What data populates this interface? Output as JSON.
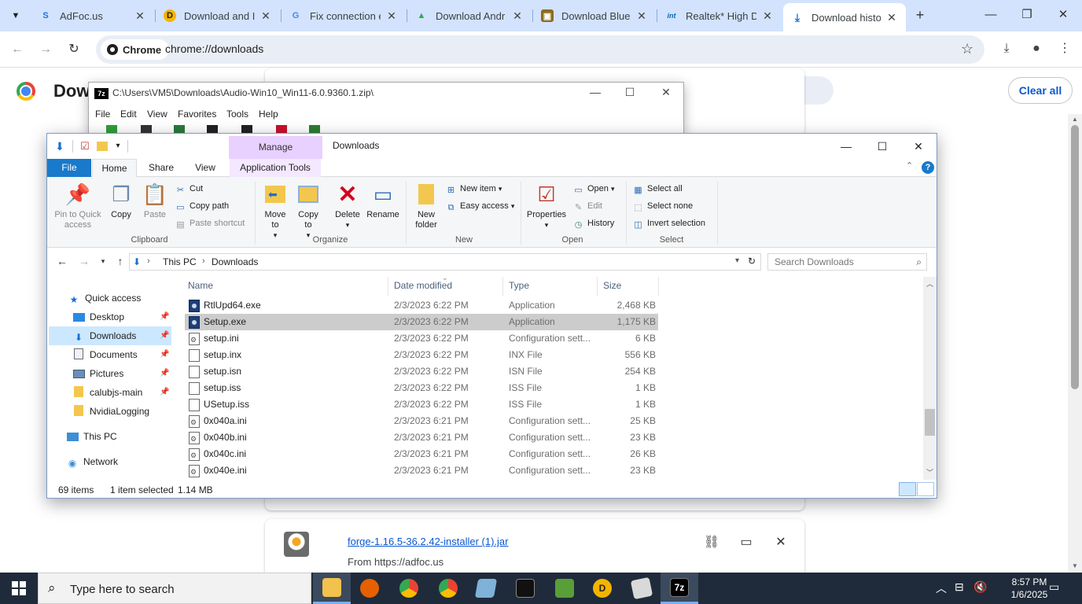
{
  "browser": {
    "tabs": [
      {
        "title": "AdFoc.us",
        "icon": "adfocus-s-icon",
        "color": "#1a73e8"
      },
      {
        "title": "Download and I",
        "icon": "driver-easy-icon",
        "color": "#f4b400"
      },
      {
        "title": "Fix connection e",
        "icon": "google-g-icon",
        "color": "#4285f4"
      },
      {
        "title": "Download Andr",
        "icon": "android-icon",
        "color": "#34a853"
      },
      {
        "title": "Download Blue",
        "icon": "softonic-box-icon",
        "color": "#8a6d1f"
      },
      {
        "title": "Realtek* High D",
        "icon": "intel-icon",
        "color": "#0068b5"
      },
      {
        "title": "Download histo",
        "icon": "download-arrow-icon",
        "color": "#1a73e8"
      }
    ],
    "site_chip": "Chrome",
    "url": "chrome://downloads"
  },
  "downloads_page": {
    "title": "Dow",
    "clear_all": "Clear all",
    "items": [
      {
        "file": "forge-1.16.5-36.2.42-installer (1).jar",
        "from": "From https://adfoc.us"
      }
    ]
  },
  "sevenzip": {
    "title": "C:\\Users\\VM5\\Downloads\\Audio-Win10_Win11-6.0.9360.1.zip\\",
    "menu": [
      "File",
      "Edit",
      "View",
      "Favorites",
      "Tools",
      "Help"
    ]
  },
  "explorer": {
    "title": "Downloads",
    "manage": "Manage",
    "ribbon_tabs": {
      "file": "File",
      "home": "Home",
      "share": "Share",
      "view": "View",
      "apptools": "Application Tools"
    },
    "ribbon": {
      "clipboard": {
        "label": "Clipboard",
        "pin": "Pin to Quick access",
        "copy": "Copy",
        "paste": "Paste",
        "cut": "Cut",
        "copy_path": "Copy path",
        "paste_shortcut": "Paste shortcut"
      },
      "organize": {
        "label": "Organize",
        "move_to": "Move to",
        "copy_to": "Copy to",
        "delete": "Delete",
        "rename": "Rename"
      },
      "new": {
        "label": "New",
        "new_folder": "New folder",
        "new_item": "New item",
        "easy_access": "Easy access"
      },
      "open": {
        "label": "Open",
        "properties": "Properties",
        "open": "Open",
        "edit": "Edit",
        "history": "History"
      },
      "select": {
        "label": "Select",
        "select_all": "Select all",
        "select_none": "Select none",
        "invert": "Invert selection"
      }
    },
    "address": {
      "segments": [
        "This PC",
        "Downloads"
      ],
      "search_placeholder": "Search Downloads"
    },
    "nav": {
      "quick_access": "Quick access",
      "pinned": [
        {
          "label": "Desktop",
          "icon": "desktop-icon"
        },
        {
          "label": "Downloads",
          "icon": "downloads-icon"
        },
        {
          "label": "Documents",
          "icon": "documents-icon"
        },
        {
          "label": "Pictures",
          "icon": "pictures-icon"
        },
        {
          "label": "calubjs-main",
          "icon": "folder-icon"
        },
        {
          "label": "NvidiaLogging",
          "icon": "folder-icon"
        }
      ],
      "this_pc": "This PC",
      "network": "Network"
    },
    "columns": {
      "name": "Name",
      "date": "Date modified",
      "type": "Type",
      "size": "Size"
    },
    "files": [
      {
        "name": "RtlUpd64.exe",
        "date": "2/3/2023 6:22 PM",
        "type": "Application",
        "size": "2,468 KB",
        "icon": "app"
      },
      {
        "name": "Setup.exe",
        "date": "2/3/2023 6:22 PM",
        "type": "Application",
        "size": "1,175 KB",
        "icon": "app"
      },
      {
        "name": "setup.ini",
        "date": "2/3/2023 6:22 PM",
        "type": "Configuration sett...",
        "size": "6 KB",
        "icon": "cfg"
      },
      {
        "name": "setup.inx",
        "date": "2/3/2023 6:22 PM",
        "type": "INX File",
        "size": "556 KB",
        "icon": "doc"
      },
      {
        "name": "setup.isn",
        "date": "2/3/2023 6:22 PM",
        "type": "ISN File",
        "size": "254 KB",
        "icon": "doc"
      },
      {
        "name": "setup.iss",
        "date": "2/3/2023 6:22 PM",
        "type": "ISS File",
        "size": "1 KB",
        "icon": "doc"
      },
      {
        "name": "USetup.iss",
        "date": "2/3/2023 6:22 PM",
        "type": "ISS File",
        "size": "1 KB",
        "icon": "doc"
      },
      {
        "name": "0x040a.ini",
        "date": "2/3/2023 6:21 PM",
        "type": "Configuration sett...",
        "size": "25 KB",
        "icon": "cfg"
      },
      {
        "name": "0x040b.ini",
        "date": "2/3/2023 6:21 PM",
        "type": "Configuration sett...",
        "size": "23 KB",
        "icon": "cfg"
      },
      {
        "name": "0x040c.ini",
        "date": "2/3/2023 6:21 PM",
        "type": "Configuration sett...",
        "size": "26 KB",
        "icon": "cfg"
      },
      {
        "name": "0x040e.ini",
        "date": "2/3/2023 6:21 PM",
        "type": "Configuration sett...",
        "size": "23 KB",
        "icon": "cfg"
      }
    ],
    "selected_index": 1,
    "status": {
      "count": "69 items",
      "selected": "1 item selected",
      "size": "1.14 MB"
    }
  },
  "taskbar": {
    "search_placeholder": "Type here to search",
    "time": "8:57 PM",
    "date": "1/6/2025",
    "apps": [
      {
        "name": "file-explorer-icon",
        "label": "",
        "color": "#f2c14e"
      },
      {
        "name": "firefox-icon",
        "label": "",
        "color": "#e66000"
      },
      {
        "name": "chrome-icon",
        "label": "",
        "color": "#34a853"
      },
      {
        "name": "chrome-profile-icon",
        "label": "",
        "color": "#4285f4"
      },
      {
        "name": "notepad-icon",
        "label": "",
        "color": "#7fb2d9"
      },
      {
        "name": "terminal-icon",
        "label": "",
        "color": "#111111"
      },
      {
        "name": "minecraft-icon",
        "label": "",
        "color": "#5a9e3a"
      },
      {
        "name": "driver-easy-icon",
        "label": "",
        "color": "#f4b400"
      },
      {
        "name": "app-installer-icon",
        "label": "",
        "color": "#d9d9d9"
      },
      {
        "name": "sevenzip-icon",
        "label": "7z",
        "color": "#000000"
      }
    ]
  }
}
